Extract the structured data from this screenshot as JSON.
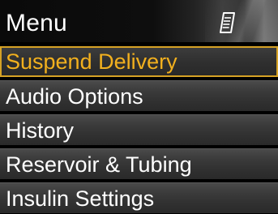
{
  "header": {
    "title": "Menu",
    "icon": "notepad-icon"
  },
  "menu": {
    "items": [
      {
        "label": "Suspend Delivery",
        "selected": true
      },
      {
        "label": "Audio Options",
        "selected": false
      },
      {
        "label": "History",
        "selected": false
      },
      {
        "label": "Reservoir & Tubing",
        "selected": false
      },
      {
        "label": "Insulin Settings",
        "selected": false
      }
    ]
  },
  "colors": {
    "background": "#000000",
    "text": "#ffffff",
    "selected_text": "#f2b01e",
    "selected_border": "#d6a225"
  }
}
